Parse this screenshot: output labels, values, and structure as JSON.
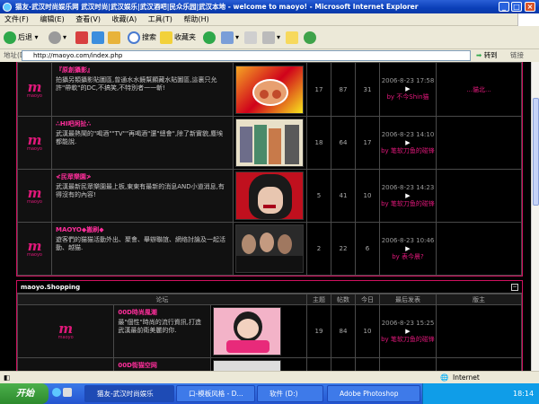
{
  "window": {
    "title": "猫友-武汉时尚娱乐网 武汉时尚|武汉娱乐|武汉酒吧|民众乐园|武汉本地 - welcome to maoyo! - Microsoft Internet Explorer"
  },
  "menu": [
    "文件(F)",
    "编辑(E)",
    "查看(V)",
    "收藏(A)",
    "工具(T)",
    "帮助(H)"
  ],
  "toolbar": {
    "back": "后退",
    "search": "搜索",
    "favorites": "收藏夹"
  },
  "address": {
    "label": "地址(D)",
    "url": "http://maoyo.com/index.php",
    "go": "转到",
    "links": "链接"
  },
  "forums_top": [
    {
      "name": "『原創攝影』",
      "desc": "拍攝另類攝影貼圖區,曾通水水鏡幫顯藏水貼圖區,這裏只允許\"帶軟\"的DC,不搞笑,不特別者一一斬!",
      "topics": "17",
      "posts": "87",
      "today": "31",
      "last_date": "2006-8-23 17:58",
      "last_by": "by 不今Shin猫",
      "mod": "...貓北..."
    },
    {
      "name": "∴HI吧闲扯∴",
      "desc": "武漢最熱鬧的\"喝酒\"\"TV\"\"再喝酒\"還\"總會\",除了新實貌,塵埃都能說.",
      "topics": "18",
      "posts": "64",
      "today": "17",
      "last_date": "2006-8-23 14:10",
      "last_by": "by 笔软刀鱼的碰锋",
      "mod": ""
    },
    {
      "name": "≮民眾樂園≯",
      "desc": "武漢最新民眾樂園最上板,東東有最新的消息AND小道消息,有得沒有的內容!",
      "topics": "5",
      "posts": "41",
      "today": "10",
      "last_date": "2006-8-23 14:23",
      "last_by": "by 笔软刀鱼的碰锋",
      "mod": ""
    },
    {
      "name": "MAOYO◆搬刷◆",
      "desc": "遊客們的猫猫活動外出、聚會、舉辦聯誼、網络討論及一起活動、越猫.",
      "topics": "2",
      "posts": "22",
      "today": "6",
      "last_date": "2006-8-23 10:46",
      "last_by": "by 表今晨?",
      "mod": ""
    }
  ],
  "section2": {
    "title": "maoyo.Shopping",
    "columns": [
      "论坛",
      "主题",
      "帖数",
      "今日",
      "最后发表",
      "版主"
    ],
    "forums": [
      {
        "name": "00D時尚風潮",
        "desc": "最\"個性\"時尚的流行資訊,打造武漢最前衛美麗的你.",
        "topics": "19",
        "posts": "84",
        "today": "10",
        "last_date": "2006-8-23 15:25",
        "last_by": "by 笔软刀鱼的碰锋",
        "mod": ""
      },
      {
        "name": "00D街猫空网",
        "desc": "",
        "topics": "",
        "posts": "",
        "today": "",
        "last_date": "",
        "last_by": "",
        "mod": ""
      }
    ]
  },
  "logo_text": "m",
  "logo_sub": "maoyo",
  "status": {
    "zone": "Internet"
  },
  "taskbar": {
    "start": "开始",
    "tasks": [
      "猫友-武汉时尚娱乐",
      "口-模板风格 - D...",
      "软件 (D:)",
      "Adobe Photoshop"
    ],
    "time": "18:14"
  },
  "colors": {
    "accent_pink": "#e0187a",
    "xp_blue": "#2455d0"
  }
}
